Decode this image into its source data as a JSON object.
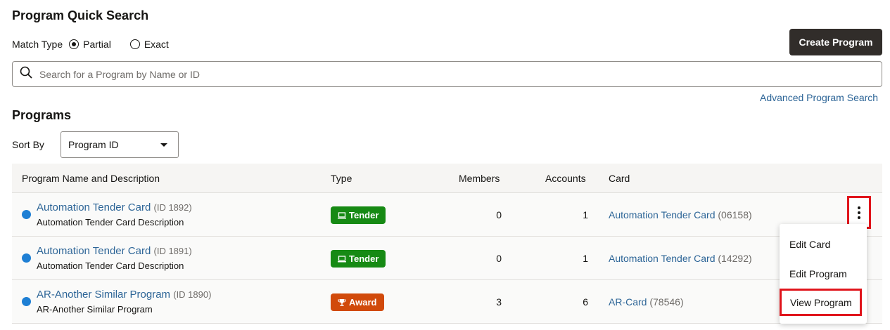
{
  "header": {
    "title": "Program Quick Search",
    "create_label": "Create Program"
  },
  "match": {
    "label": "Match Type",
    "options": [
      "Partial",
      "Exact"
    ],
    "selected": "Partial"
  },
  "search": {
    "placeholder": "Search for a Program by Name or ID"
  },
  "advanced_link": "Advanced Program Search",
  "programs": {
    "title": "Programs",
    "sort_label": "Sort By",
    "sort_value": "Program ID"
  },
  "table": {
    "columns": [
      "Program Name and Description",
      "Type",
      "Members",
      "Accounts",
      "Card"
    ],
    "rows": [
      {
        "name": "Automation Tender Card",
        "id": "(ID 1892)",
        "desc": "Automation Tender Card Description",
        "type": "Tender",
        "members": "0",
        "accounts": "1",
        "card": "Automation Tender Card",
        "card_id": "(06158)"
      },
      {
        "name": "Automation Tender Card",
        "id": "(ID 1891)",
        "desc": "Automation Tender Card Description",
        "type": "Tender",
        "members": "0",
        "accounts": "1",
        "card": "Automation Tender Card",
        "card_id": "(14292)"
      },
      {
        "name": "AR-Another Similar Program",
        "id": "(ID 1890)",
        "desc": "AR-Another Similar Program",
        "type": "Award",
        "members": "3",
        "accounts": "6",
        "card": "AR-Card",
        "card_id": "(78546)"
      }
    ]
  },
  "menu": {
    "items": [
      "Edit Card",
      "Edit Program",
      "View Program"
    ]
  },
  "colors": {
    "tender": "#168a14",
    "award": "#d14a0b",
    "link": "#2d6597",
    "highlight": "#e0141b"
  }
}
